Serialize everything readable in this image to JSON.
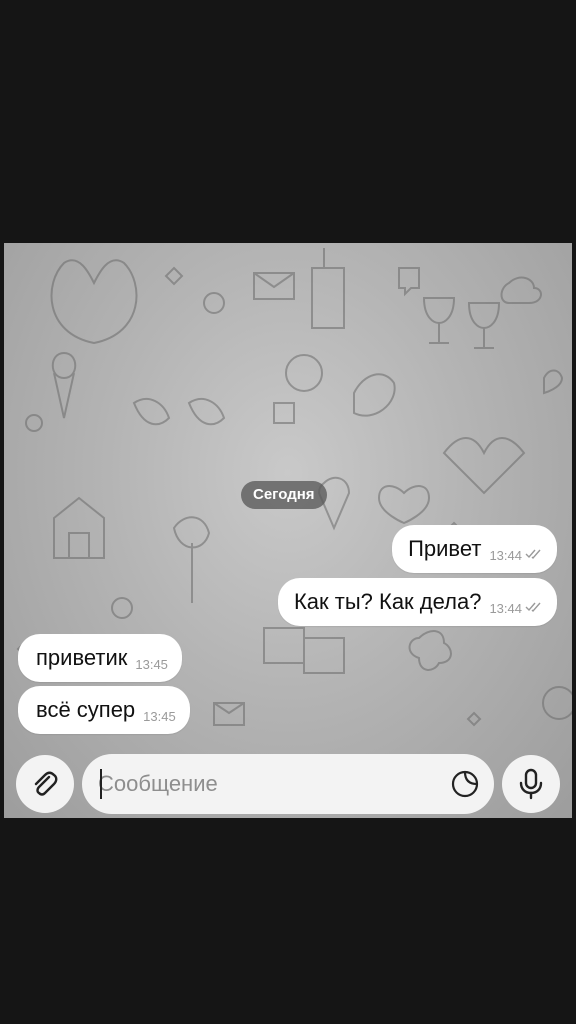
{
  "chat": {
    "date_label": "Сегодня",
    "messages": [
      {
        "direction": "outgoing",
        "text": "Привет",
        "time": "13:44",
        "status": "read"
      },
      {
        "direction": "outgoing",
        "text": "Как ты? Как дела?",
        "time": "13:44",
        "status": "read"
      },
      {
        "direction": "incoming",
        "text": "приветик",
        "time": "13:45"
      },
      {
        "direction": "incoming",
        "text": "всё супер",
        "time": "13:45"
      }
    ]
  },
  "composer": {
    "placeholder": "Сообщение",
    "value": "",
    "attach_icon": "paperclip-icon",
    "sticker_icon": "sticker-icon",
    "mic_icon": "microphone-icon"
  },
  "colors": {
    "bubble": "#ffffff",
    "date_chip": "#5a5a5a",
    "wallpaper": "#b4b4b4"
  }
}
